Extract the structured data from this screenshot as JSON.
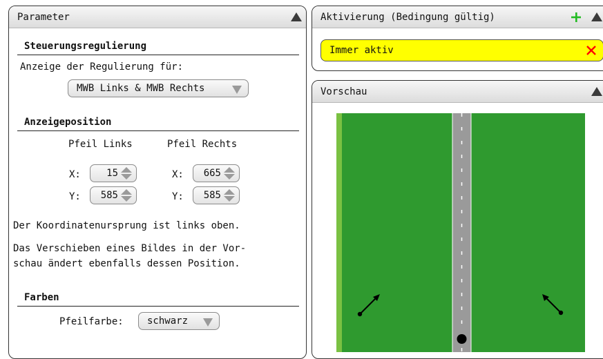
{
  "parameter": {
    "title": "Parameter",
    "steuerung": {
      "heading": "Steuerungsregulierung",
      "label": "Anzeige der Regulierung für:",
      "select_value": "MWB Links & MWB Rechts"
    },
    "position": {
      "heading": "Anzeigeposition",
      "col_left": "Pfeil Links",
      "col_right": "Pfeil Rechts",
      "x_label": "X:",
      "y_label": "Y:",
      "left_x": "15",
      "left_y": "585",
      "right_x": "665",
      "right_y": "585",
      "note1": "Der Koordinatenursprung ist links oben.",
      "note2_line1": "Das Verschieben eines Bildes in der Vor-",
      "note2_line2": "schau ändert ebenfalls dessen Position."
    },
    "farben": {
      "heading": "Farben",
      "label": "Pfeilfarbe:",
      "select_value": "schwarz"
    }
  },
  "aktivierung": {
    "title": "Aktivierung (Bedingung gültig)",
    "condition": "Immer aktiv"
  },
  "vorschau": {
    "title": "Vorschau"
  },
  "colors": {
    "road_green": "#2f9a2f",
    "road_edge": "#7ac142",
    "road_gray": "#9a9a9a",
    "condition_yellow": "#ffff00",
    "add_green": "#22bb22",
    "delete_red": "#ff0000"
  }
}
